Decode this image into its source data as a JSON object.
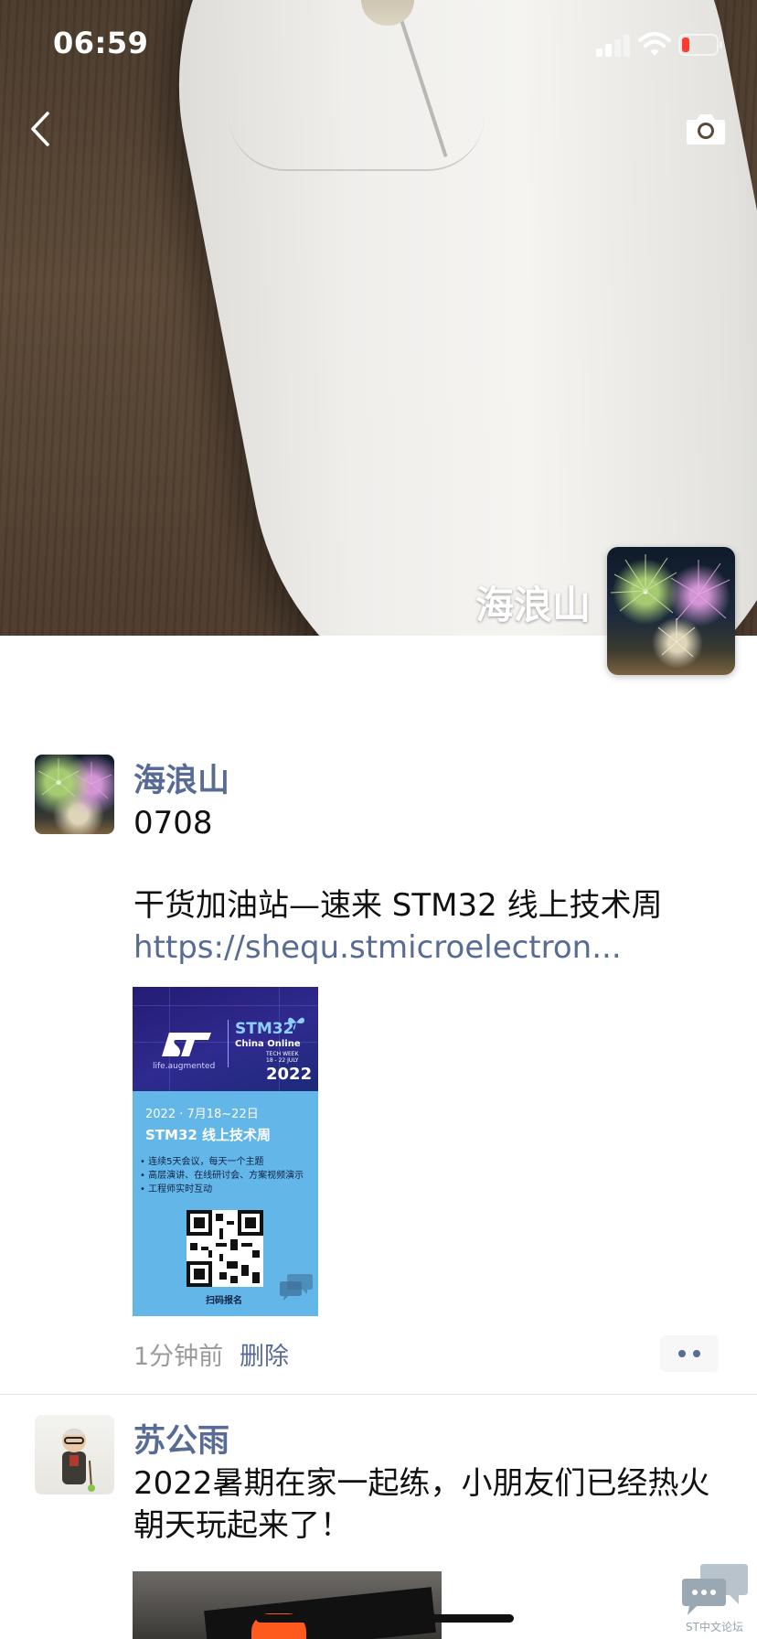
{
  "status_bar": {
    "time": "06:59",
    "icons": [
      "signal-icon",
      "wifi-icon",
      "battery-low-icon"
    ],
    "battery_color": "#ff3b30"
  },
  "header": {
    "back_icon": "chevron-left-icon",
    "camera_icon": "camera-icon"
  },
  "cover": {
    "owner_name": "海浪山"
  },
  "posts": [
    {
      "author": "海浪山",
      "text_line1": "0708",
      "text_main": "干货加油站—速来 STM32 线上技术周 ",
      "link": "https://shequ.stmicroelectron...",
      "time": "1分钟前",
      "delete_label": "删除",
      "poster": {
        "tagline": "life.augmented",
        "brand": "STM32",
        "subtitle_line1": "China Online",
        "subtitle_small1": "TECH WEEK",
        "subtitle_small2": "18 - 22 JULY",
        "year": "2022",
        "date": "2022 · 7月18~22日",
        "title": "STM32 线上技术周",
        "bullets": [
          "• 连续5天会议，每天一个主题",
          "• 高层演讲、在线研讨会、方案视频演示",
          "• 工程师实时互动"
        ],
        "scan_label": "扫码报名",
        "watermark": "ST中文论坛"
      }
    },
    {
      "author": "苏公雨",
      "text": "2022暑期在家一起练，小朋友们已经热火朝天玩起来了！"
    }
  ],
  "watermark": {
    "label": "ST中文论坛"
  },
  "colors": {
    "link": "#576b95",
    "meta": "#9a9a9a"
  }
}
